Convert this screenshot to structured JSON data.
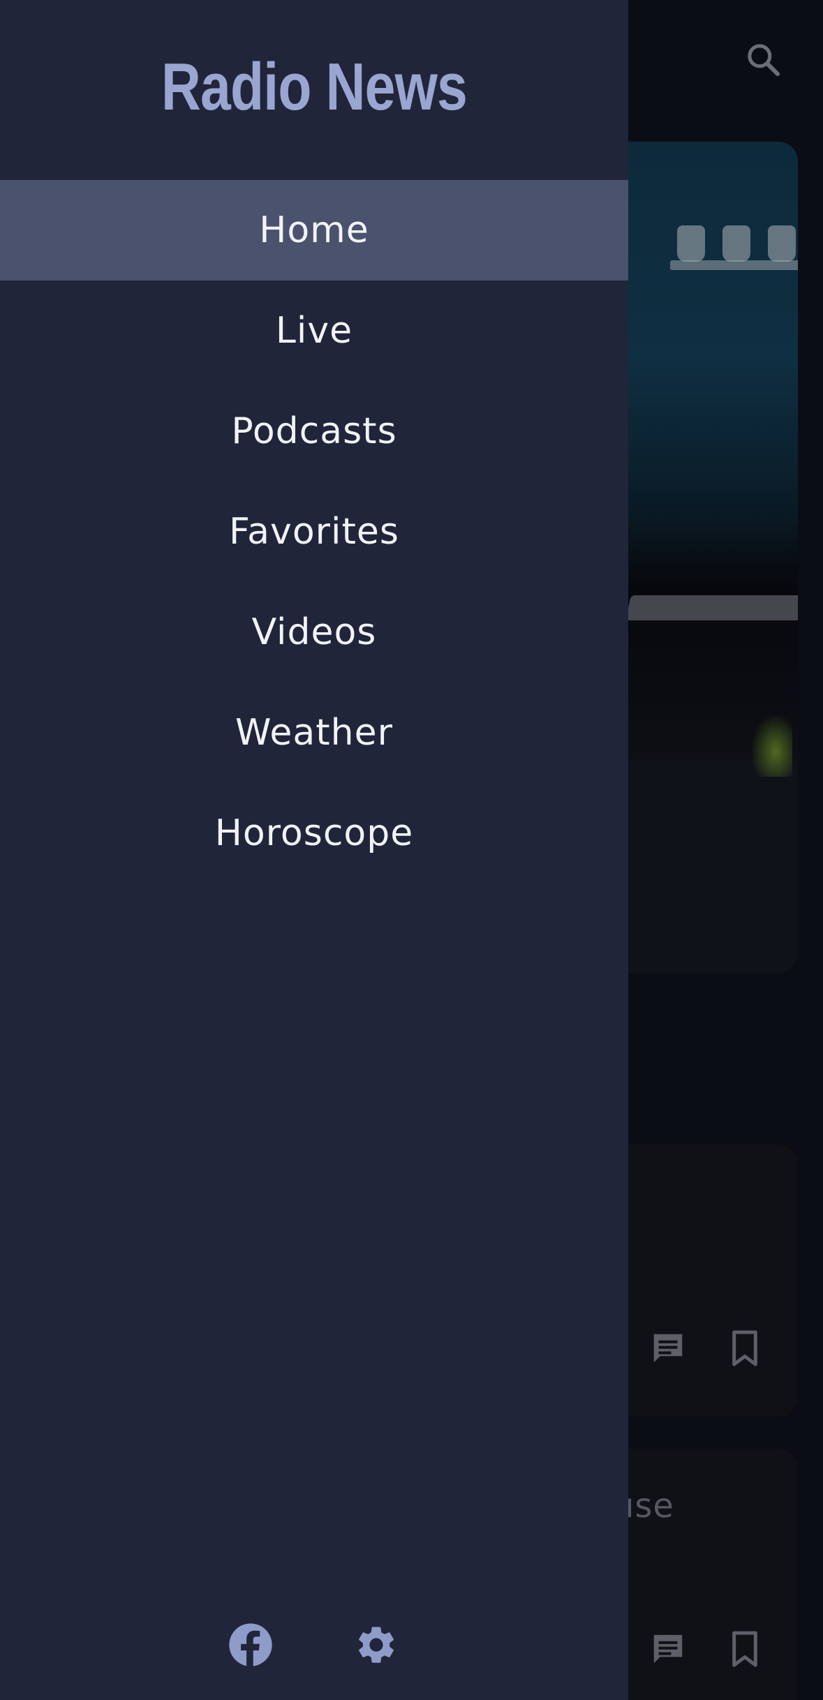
{
  "app": {
    "title": "Radio News"
  },
  "drawer": {
    "items": [
      {
        "label": "Home",
        "active": true
      },
      {
        "label": "Live",
        "active": false
      },
      {
        "label": "Podcasts",
        "active": false
      },
      {
        "label": "Favorites",
        "active": false
      },
      {
        "label": "Videos",
        "active": false
      },
      {
        "label": "Weather",
        "active": false
      },
      {
        "label": "Horoscope",
        "active": false
      }
    ],
    "footer": {
      "icons": [
        "facebook-icon",
        "settings-icon"
      ]
    }
  },
  "background": {
    "icons": [
      "search-icon",
      "comment-icon",
      "bookmark-icon"
    ],
    "card_partial_text": "use"
  },
  "colors": {
    "drawer_bg": "#20253a",
    "active_item_bg": "#4a526d",
    "accent": "#9aa6d1",
    "scrim": "#0b0d16"
  }
}
